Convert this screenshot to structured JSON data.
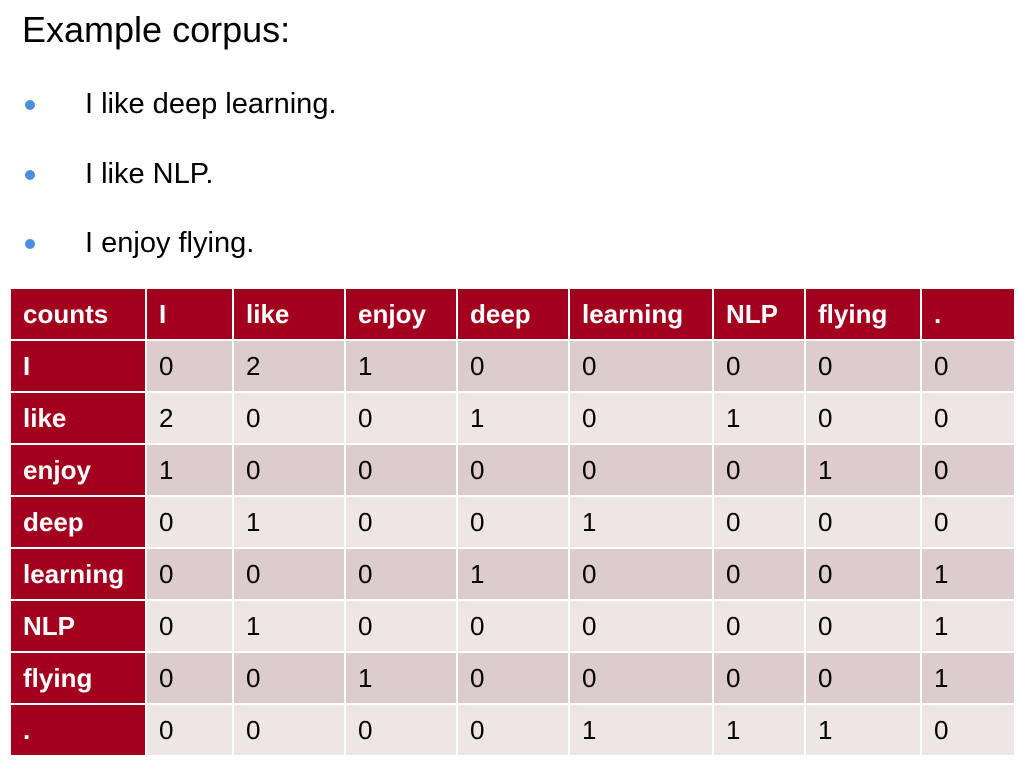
{
  "heading": "Example corpus:",
  "bullets": [
    "I like deep learning.",
    "I like NLP.",
    "I enjoy flying."
  ],
  "table": {
    "headers": [
      "counts",
      "I",
      "like",
      "enjoy",
      "deep",
      "learning",
      "NLP",
      "flying",
      "."
    ],
    "rows": [
      {
        "label": "I",
        "values": [
          "0",
          "2",
          "1",
          "0",
          "0",
          "0",
          "0",
          "0"
        ]
      },
      {
        "label": "like",
        "values": [
          "2",
          "0",
          "0",
          "1",
          "0",
          "1",
          "0",
          "0"
        ]
      },
      {
        "label": "enjoy",
        "values": [
          "1",
          "0",
          "0",
          "0",
          "0",
          "0",
          "1",
          "0"
        ]
      },
      {
        "label": "deep",
        "values": [
          "0",
          "1",
          "0",
          "0",
          "1",
          "0",
          "0",
          "0"
        ]
      },
      {
        "label": "learning",
        "values": [
          "0",
          "0",
          "0",
          "1",
          "0",
          "0",
          "0",
          "1"
        ]
      },
      {
        "label": "NLP",
        "values": [
          "0",
          "1",
          "0",
          "0",
          "0",
          "0",
          "0",
          "1"
        ]
      },
      {
        "label": "flying",
        "values": [
          "0",
          "0",
          "1",
          "0",
          "0",
          "0",
          "0",
          "1"
        ]
      },
      {
        "label": ".",
        "values": [
          "0",
          "0",
          "0",
          "0",
          "1",
          "1",
          "1",
          "0"
        ]
      }
    ]
  },
  "colors": {
    "header_bg": "#a3001e",
    "row_odd_bg": "#dccccd",
    "row_even_bg": "#eee6e6",
    "bullet_dot": "#4a8fe0"
  }
}
